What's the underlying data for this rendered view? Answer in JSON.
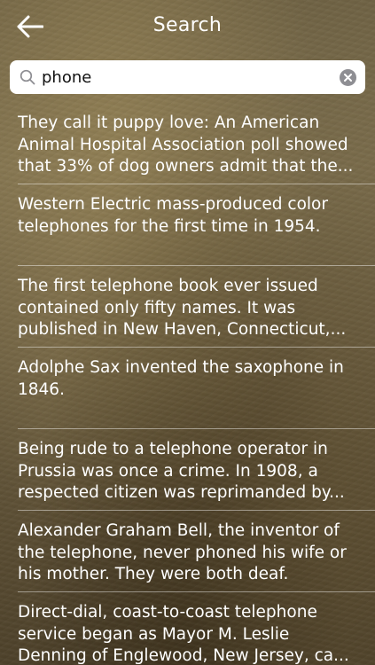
{
  "header": {
    "title": "Search",
    "back_icon": "arrow-left-icon"
  },
  "search": {
    "value": "phone",
    "placeholder": "Search",
    "search_icon": "magnifier-icon",
    "clear_icon": "clear-icon"
  },
  "results": [
    {
      "text": "They call it puppy love: An American Animal Hospital Association poll showed that 33% of dog owners admit that the..."
    },
    {
      "text": "Western Electric mass-produced color telephones for the first time in 1954."
    },
    {
      "text": "The first telephone book ever issued contained only fifty names. It was published in New Haven, Connecticut,..."
    },
    {
      "text": "Adolphe Sax invented the saxophone in 1846."
    },
    {
      "text": "Being rude to a telephone operator in Prussia was once a crime. In 1908, a respected citizen was reprimanded by..."
    },
    {
      "text": "Alexander Graham Bell, the inventor of the telephone, never phoned his wife or his mother. They were both deaf."
    },
    {
      "text": "Direct-dial, coast-to-coast telephone service began as Mayor M. Leslie Denning of Englewood, New Jersey, ca..."
    }
  ],
  "colors": {
    "text": "#ffffff",
    "search_background": "#ffffff",
    "clear_button": "#8e8e93"
  }
}
